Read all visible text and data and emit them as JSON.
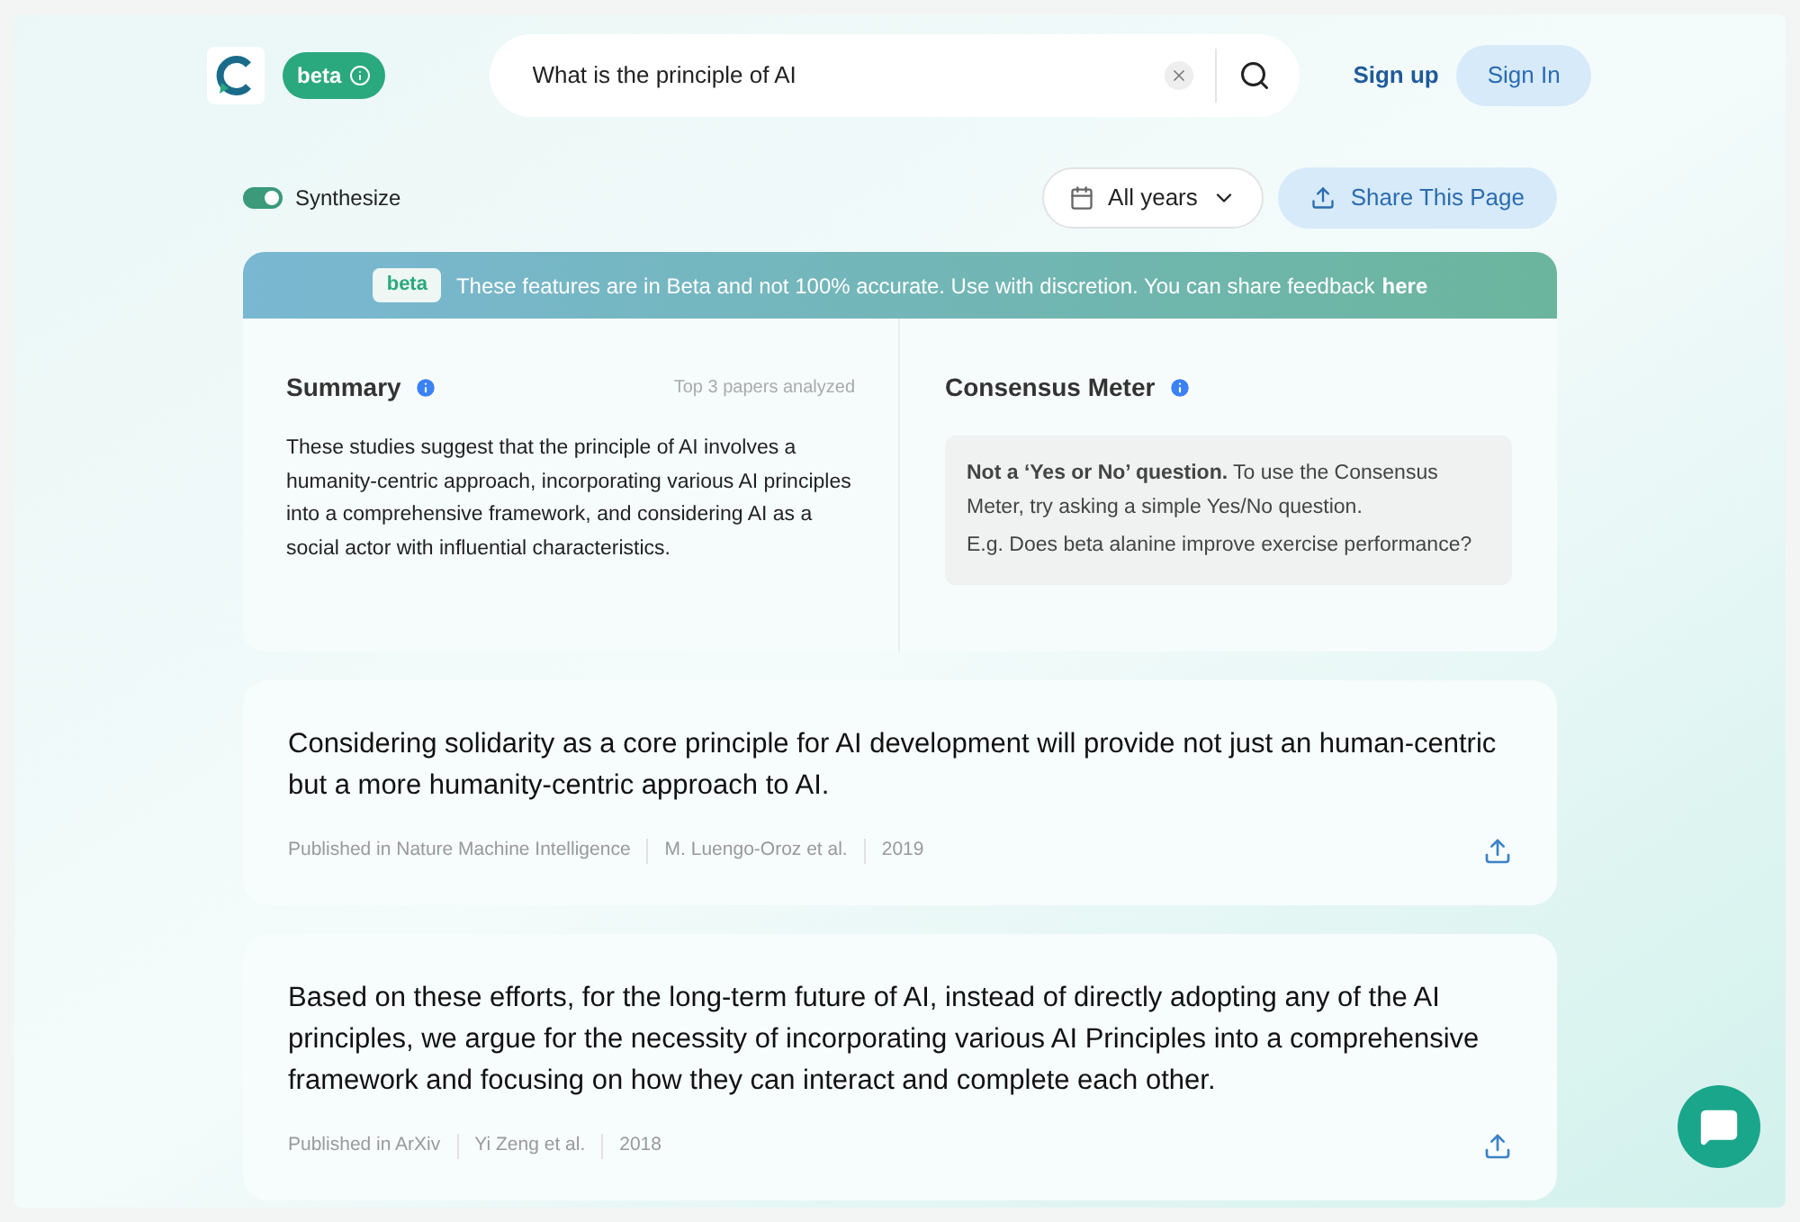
{
  "header": {
    "badge": "beta",
    "search": {
      "value": "What is the principle of AI"
    },
    "signup": "Sign up",
    "signin": "Sign In"
  },
  "toolbar": {
    "synthesize": {
      "label": "Synthesize",
      "on": true
    },
    "years": "All years",
    "share": "Share This Page"
  },
  "banner": {
    "badge": "beta",
    "text": "These features are in Beta and not 100% accurate. Use with discretion. You can share feedback",
    "link": "here"
  },
  "summary": {
    "title": "Summary",
    "note": "Top 3 papers analyzed",
    "text": "These studies suggest that the principle of AI involves a humanity-centric approach, incorporating various AI principles into a comprehensive framework, and considering AI as a social actor with influential characteristics."
  },
  "consensus": {
    "title": "Consensus Meter",
    "message": "**Not a ‘Yes or No’ question.** To use the Consensus Meter, try asking a simple Yes/No question.",
    "example": "E.g. Does beta alanine improve exercise performance?"
  },
  "results": [
    {
      "claim": "Considering solidarity as a core principle for AI development will provide not just an human-centric but a more humanity-centric approach to AI.",
      "journal": "Published in Nature Machine Intelligence",
      "authors": "M. Luengo-Oroz et al.",
      "year": "2019"
    },
    {
      "claim": "Based on these efforts, for the long-term future of AI, instead of directly adopting any of the AI principles, we argue for the necessity of incorporating various AI Principles into a comprehensive framework and focusing on how they can interact and complete each other.",
      "journal": "Published in ArXiv",
      "authors": "Yi Zeng et al.",
      "year": "2018"
    }
  ]
}
